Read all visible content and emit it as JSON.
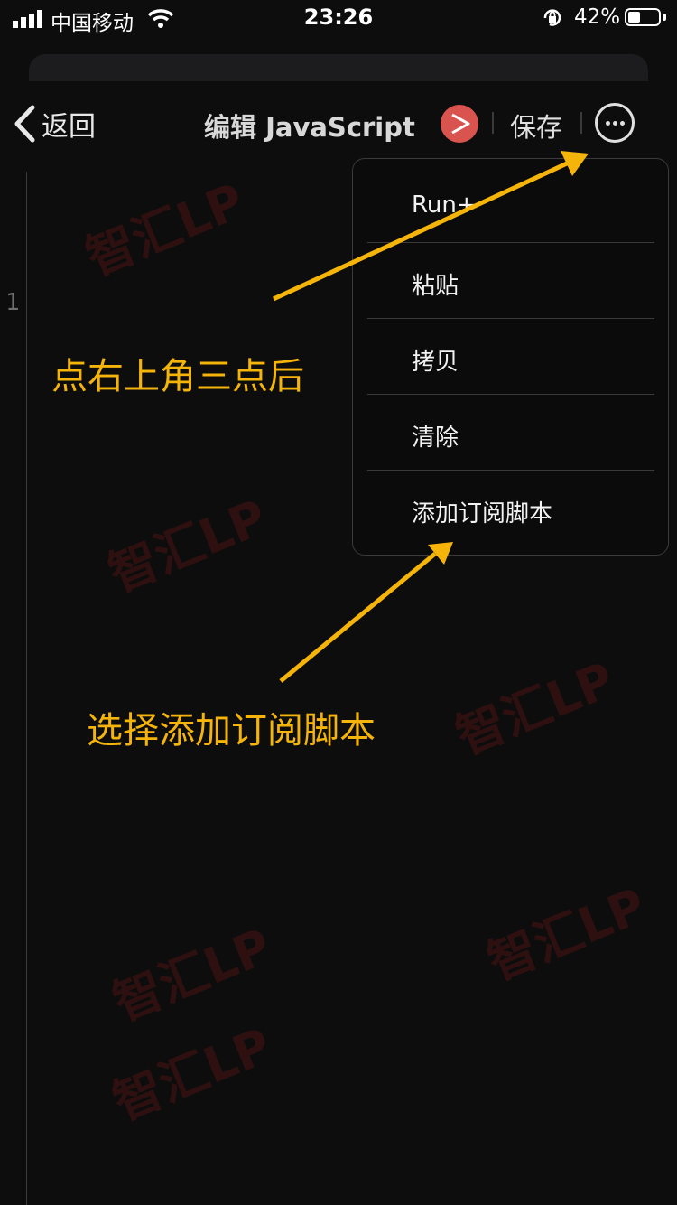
{
  "status_bar": {
    "carrier": "中国移动",
    "time": "23:26",
    "battery": "42%"
  },
  "nav": {
    "back_label": "返回",
    "title": "编辑 JavaScript",
    "save_label": "保存"
  },
  "editor": {
    "line_number": "1"
  },
  "menu": {
    "items": [
      "Run+",
      "粘贴",
      "拷贝",
      "清除",
      "添加订阅脚本"
    ]
  },
  "annotations": {
    "step1": "点右上角三点后",
    "step2": "选择添加订阅脚本"
  },
  "watermark": "智汇LP",
  "colors": {
    "background": "#0d0d0d",
    "annotation": "#f5b40a",
    "run_button": "#d9534f"
  }
}
